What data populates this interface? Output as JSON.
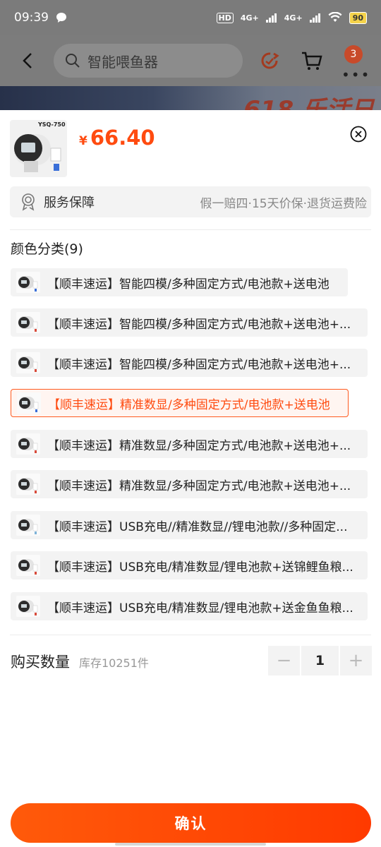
{
  "status_bar": {
    "time": "09:39",
    "hd": "HD",
    "net1": "4G+",
    "net2": "4G+",
    "battery": "90"
  },
  "nav": {
    "search_placeholder": "智能喂鱼器",
    "cart_badge": "3"
  },
  "banner": {
    "text": "618 乐活日"
  },
  "product": {
    "thumb_label": "YSQ-750",
    "currency": "¥",
    "price": "66.40"
  },
  "service": {
    "title": "服务保障",
    "desc": "假一赔四·15天价保·退货运费险"
  },
  "options": {
    "title": "颜色分类(9)",
    "selected_index": 3,
    "items": [
      {
        "label": "【顺丰速运】智能四模/多种固定方式/电池款+送电池",
        "thumb_label": "YSQ-740"
      },
      {
        "label": "【顺丰速运】智能四模/多种固定方式/电池款+送电池+...",
        "thumb_label": "YSQ-740"
      },
      {
        "label": "【顺丰速运】智能四模/多种固定方式/电池款+送电池+...",
        "thumb_label": "YSQ-740"
      },
      {
        "label": "【顺丰速运】精准数显/多种固定方式/电池款+送电池",
        "thumb_label": "YSQ-750"
      },
      {
        "label": "【顺丰速运】精准数显/多种固定方式/电池款+送电池+...",
        "thumb_label": "YSQ-750"
      },
      {
        "label": "【顺丰速运】精准数显/多种固定方式/电池款+送电池+...",
        "thumb_label": "YSQ-750"
      },
      {
        "label": "【顺丰速运】USB充电//精准数显//锂电池款//多种固定...",
        "thumb_label": "YSQ-760"
      },
      {
        "label": "【顺丰速运】USB充电/精准数显/锂电池款+送锦鲤鱼粮...",
        "thumb_label": "YSQ-760"
      },
      {
        "label": "【顺丰速运】USB充电/精准数显/锂电池款+送金鱼鱼粮...",
        "thumb_label": "YSQ-760"
      }
    ]
  },
  "quantity": {
    "title": "购买数量",
    "stock": "库存10251件",
    "value": "1",
    "minus": "−",
    "plus": "+"
  },
  "confirm": {
    "label": "确认"
  }
}
